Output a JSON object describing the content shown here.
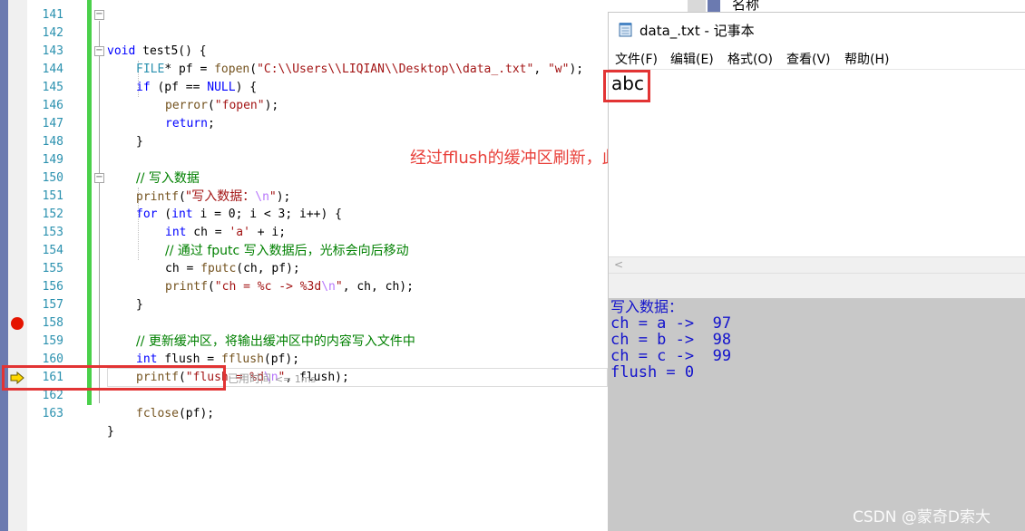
{
  "editor": {
    "line_numbers": [
      "141",
      "142",
      "143",
      "144",
      "145",
      "146",
      "147",
      "148",
      "149",
      "150",
      "151",
      "152",
      "153",
      "154",
      "155",
      "156",
      "157",
      "158",
      "159",
      "160",
      "161",
      "162",
      "163"
    ],
    "code": {
      "l141": "",
      "l142_kw": "void",
      "l142_rest": " test5() {",
      "l143_type": "FILE",
      "l143_a": "* pf = ",
      "l143_fn": "fopen",
      "l143_b": "(",
      "l143_str": "\"C:\\\\Users\\\\LIQIAN\\\\Desktop\\\\data_.txt\"",
      "l143_c": ", ",
      "l143_str2": "\"w\"",
      "l143_d": ");",
      "l144_kw": "if",
      "l144_a": " (pf == ",
      "l144_null": "NULL",
      "l144_b": ") {",
      "l145_fn": "perror",
      "l145_a": "(",
      "l145_str": "\"fopen\"",
      "l145_b": ");",
      "l146_kw": "return",
      "l146_a": ";",
      "l147": "}",
      "l149_cmt": "// 写入数据",
      "l150_fn": "printf",
      "l150_a": "(",
      "l150_str": "\"写入数据：",
      "l150_esc": "\\n",
      "l150_str_end": "\"",
      "l150_b": ");",
      "l151_kw": "for",
      "l151_a": " (",
      "l151_kw2": "int",
      "l151_b": " i = 0; i < 3; i++) {",
      "l152_kw": "int",
      "l152_a": " ch = ",
      "l152_str": "'a'",
      "l152_b": " + i;",
      "l153_cmt": "// 通过 fputc 写入数据后，光标会向后移动",
      "l154_a": "ch = ",
      "l154_fn": "fputc",
      "l154_b": "(ch, pf);",
      "l155_fn": "printf",
      "l155_a": "(",
      "l155_str": "\"ch = %c -> %3d",
      "l155_esc": "\\n",
      "l155_str_end": "\"",
      "l155_b": ", ch, ch);",
      "l156": "}",
      "l158_cmt": "// 更新缓冲区，将输出缓冲区中的内容写入文件中",
      "l159_kw": "int",
      "l159_a": " flush = ",
      "l159_fn": "fflush",
      "l159_b": "(pf);",
      "l160_fn": "printf",
      "l160_a": "(",
      "l160_str": "\"flush = %d",
      "l160_esc": "\\n",
      "l160_str_end": "\"",
      "l160_b": ", flush);",
      "l162_fn": "fclose",
      "l162_a": "(pf);",
      "l163": "}"
    },
    "elapsed_label": "已用时间",
    "elapsed_value": "<= 1ms",
    "breakpoint_color": "#e51400",
    "icons": {
      "breakpoint": "breakpoint-icon",
      "current": "current-statement-arrow-icon"
    }
  },
  "annotation": "经过fflush的缓冲区刷新，此时文件中写入了相应数据",
  "notepad": {
    "title": "data_.txt - 记事本",
    "menus": [
      "文件(F)",
      "编辑(E)",
      "格式(O)",
      "查看(V)",
      "帮助(H)"
    ],
    "content": "abc",
    "scroll_left": "<"
  },
  "console": {
    "lines": [
      "写入数据：",
      "ch = a ->  97",
      "ch = b ->  98",
      "ch = c ->  99",
      "flush = 0"
    ]
  },
  "side_panel": {
    "header": "名称"
  },
  "watermark": "CSDN @蒙奇D索大",
  "colors": {
    "highlight": "#e23434",
    "annotation": "#e8403a",
    "console_text": "#1212cc",
    "change_bar": "#4bd04b"
  }
}
